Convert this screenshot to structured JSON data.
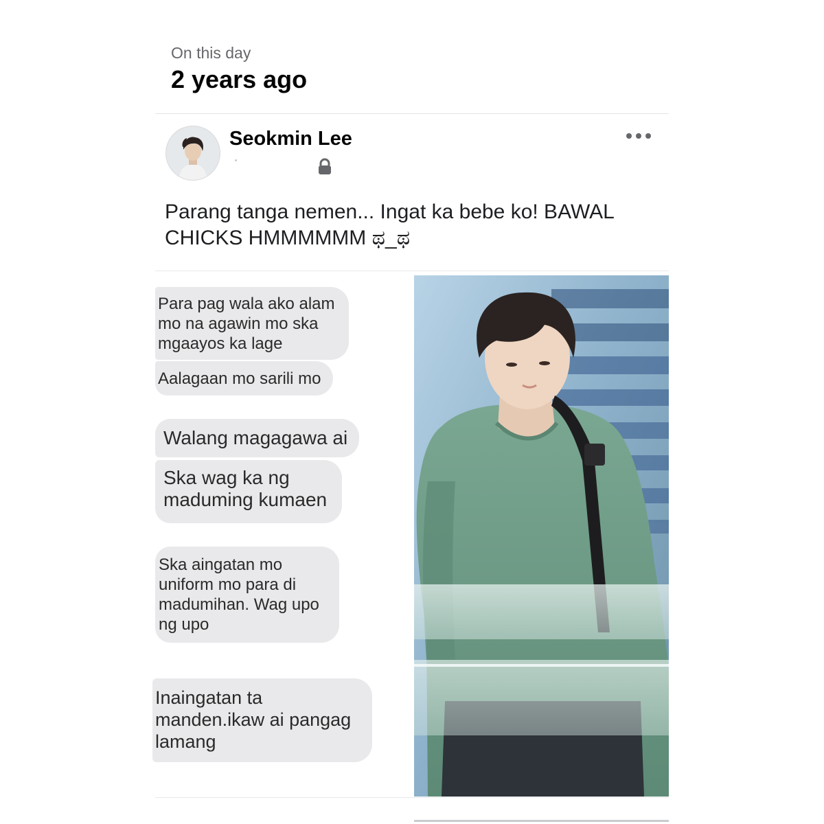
{
  "memories": {
    "subtitle": "On this day",
    "title": "2 years ago"
  },
  "post": {
    "author": "Seokmin Lee",
    "avatar_icon": "profile-photo",
    "privacy_icon": "lock-icon",
    "more_icon": "more-options-icon",
    "caption": "Parang tanga nemen... Ingat ka bebe ko! BAWAL CHICKS HMMMMMM ಥ_ಥ"
  },
  "chat_screenshot": {
    "messages": [
      "Para pag wala ako alam mo na agawin mo ska mgaayos ka lage",
      "Aalagaan mo sarili mo",
      "Walang magagawa ai",
      "Ska wag ka ng maduming kumaen",
      "Ska aingatan mo uniform mo para di madumihan. Wag upo ng upo",
      "Inaingatan ta manden.ikaw ai pangag lamang"
    ]
  },
  "photo": {
    "subject": "person-photo"
  },
  "colors": {
    "bubble": "#e9e9eb",
    "secondary_text": "#65676b",
    "divider": "#e2e3e6",
    "shirt": "#6f9d86"
  }
}
